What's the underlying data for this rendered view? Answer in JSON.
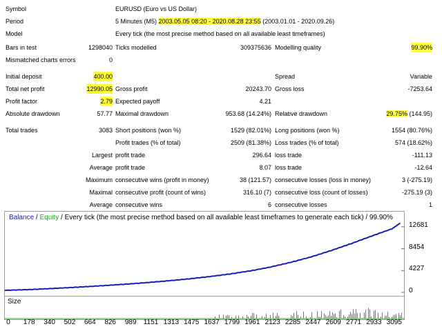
{
  "report": {
    "symbol": {
      "label": "Symbol",
      "value": "EURUSD (Euro vs US Dollar)"
    },
    "period": {
      "label": "Period",
      "prefix": "5 Minutes (M5)",
      "range": "2003.05.05 08:20 - 2020.08.28 23:55",
      "suffix": "(2003.01.01 - 2020.09.26)"
    },
    "model": {
      "label": "Model",
      "value": "Every tick (the most precise method based on all available least timeframes)"
    },
    "bars": {
      "label": "Bars in test",
      "value": "1298040",
      "ticks_label": "Ticks modelled",
      "ticks_value": "309375636",
      "quality_label": "Modelling quality",
      "quality_value": "99.90%"
    },
    "mismatched": {
      "label": "Mismatched charts errors",
      "value": "0"
    },
    "initial_deposit": {
      "label": "Initial deposit",
      "value": "400.00",
      "spread_label": "Spread",
      "spread_value": "Variable"
    },
    "net_profit": {
      "label": "Total net profit",
      "value": "12990.05",
      "gp_label": "Gross profit",
      "gp_value": "20243.70",
      "gl_label": "Gross loss",
      "gl_value": "-7253.64"
    },
    "profit_factor": {
      "label": "Profit factor",
      "value": "2.79",
      "ep_label": "Expected payoff",
      "ep_value": "4.21"
    },
    "abs_dd": {
      "label": "Absolute drawdown",
      "value": "57.77",
      "max_label": "Maximal drawdown",
      "max_value": "953.68 (14.24%)",
      "rel_label": "Relative drawdown",
      "rel_value": "29.75%",
      "rel_suffix": "(144.95)"
    },
    "total_trades": {
      "label": "Total trades",
      "value": "3083",
      "short_label": "Short positions (won %)",
      "short_value": "1529 (82.01%)",
      "long_label": "Long positions (won %)",
      "long_value": "1554 (80.76%)"
    },
    "profit_trades": {
      "label": "Profit trades (% of total)",
      "value": "2509 (81.38%)",
      "loss_label": "Loss trades (% of total)",
      "loss_value": "574 (18.62%)"
    },
    "largest": {
      "label": "Largest",
      "p_label": "profit trade",
      "p_value": "296.64",
      "l_label": "loss trade",
      "l_value": "-111.13"
    },
    "average": {
      "label": "Average",
      "p_label": "profit trade",
      "p_value": "8.07",
      "l_label": "loss trade",
      "l_value": "-12.64"
    },
    "maximum": {
      "label": "Maximum",
      "p_label": "consecutive wins (profit in money)",
      "p_value": "38 (121.57)",
      "l_label": "consecutive losses (loss in money)",
      "l_value": "3 (-275.19)"
    },
    "maximal": {
      "label": "Maximal",
      "p_label": "consecutive profit (count of wins)",
      "p_value": "316.10 (7)",
      "l_label": "consecutive loss (count of losses)",
      "l_value": "-275.19 (3)"
    },
    "average2": {
      "label": "Average",
      "p_label": "consecutive wins",
      "p_value": "6",
      "l_label": "consecutive losses",
      "l_value": "1"
    }
  },
  "chart_legend": {
    "balance": "Balance",
    "sep1": " / ",
    "equity": "Equity",
    "rest": " / Every tick (the most precise method based on all available least timeframes to generate each tick) / 99.90%"
  },
  "size_label": "Size",
  "colors": {
    "balance": "#1a1ab8",
    "equity": "#22a022",
    "highlight": "#ffff3c",
    "volume": "#22b022"
  },
  "chart_data": {
    "type": "line",
    "title": "",
    "xlabel": "",
    "ylabel": "",
    "x_ticks": [
      0,
      178,
      340,
      502,
      664,
      826,
      989,
      1151,
      1313,
      1475,
      1637,
      1799,
      1961,
      2123,
      2285,
      2447,
      2609,
      2771,
      2933,
      3095
    ],
    "y_ticks": [
      0,
      4227,
      8454,
      12681
    ],
    "xlim": [
      0,
      3190
    ],
    "ylim": [
      0,
      14000
    ],
    "series": [
      {
        "name": "Balance",
        "x": [
          0,
          178,
          340,
          502,
          664,
          826,
          989,
          1151,
          1313,
          1475,
          1637,
          1799,
          1961,
          2123,
          2285,
          2447,
          2609,
          2771,
          2933,
          3095,
          3160
        ],
        "values": [
          400,
          520,
          700,
          900,
          1120,
          1360,
          1620,
          1920,
          2250,
          2620,
          3050,
          3550,
          4150,
          4900,
          5800,
          6850,
          8100,
          9450,
          10900,
          12300,
          13390
        ]
      }
    ]
  }
}
